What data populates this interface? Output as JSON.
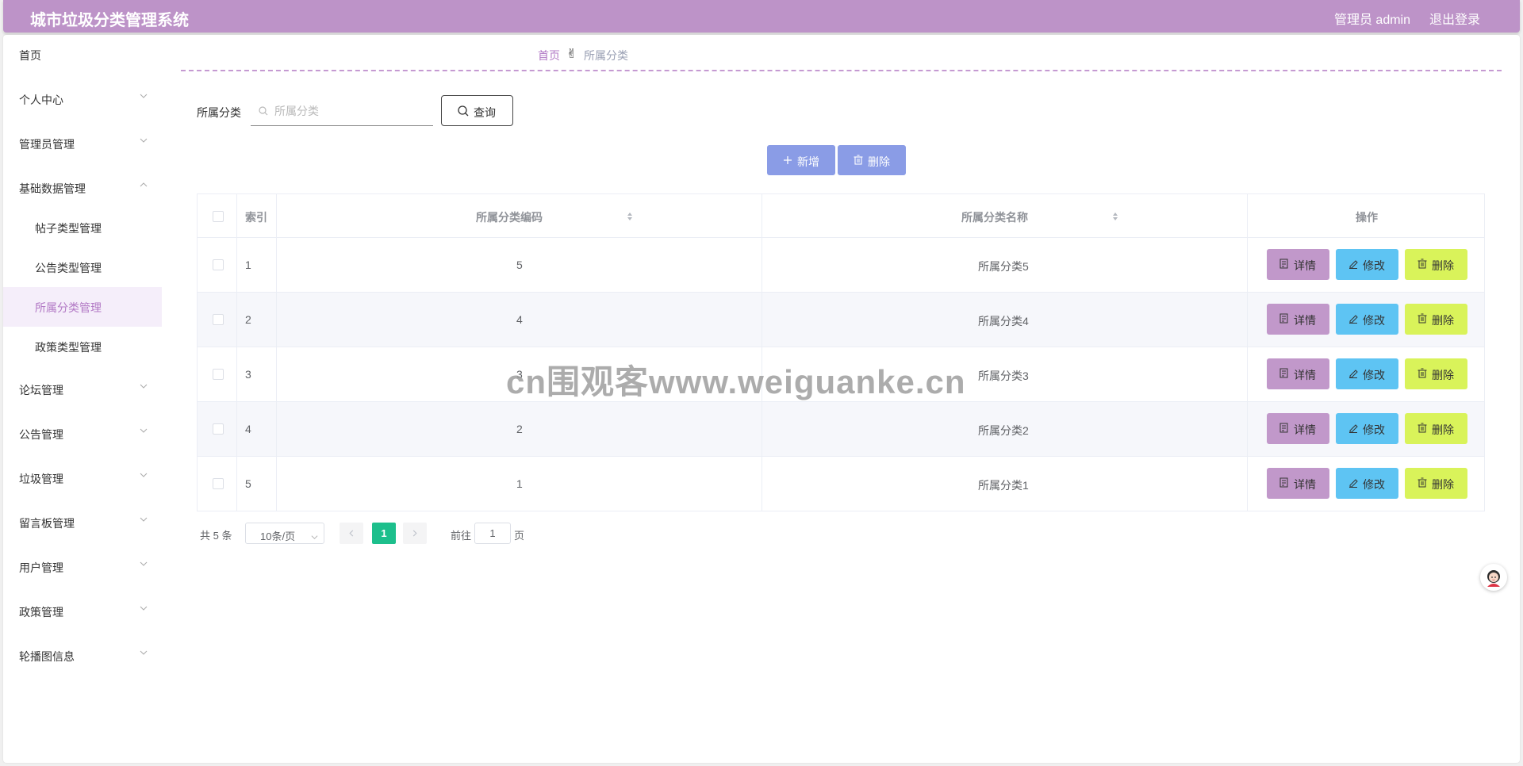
{
  "header": {
    "title": "城市垃圾分类管理系统",
    "admin_label": "管理员 admin",
    "logout_label": "退出登录"
  },
  "sidebar": {
    "items": [
      {
        "label": "首页"
      },
      {
        "label": "个人中心"
      },
      {
        "label": "管理员管理"
      },
      {
        "label": "基础数据管理"
      },
      {
        "label": "论坛管理"
      },
      {
        "label": "公告管理"
      },
      {
        "label": "垃圾管理"
      },
      {
        "label": "留言板管理"
      },
      {
        "label": "用户管理"
      },
      {
        "label": "政策管理"
      },
      {
        "label": "轮播图信息"
      }
    ],
    "sub_items": [
      {
        "label": "帖子类型管理"
      },
      {
        "label": "公告类型管理"
      },
      {
        "label": "所属分类管理"
      },
      {
        "label": "政策类型管理"
      }
    ]
  },
  "breadcrumb": {
    "home": "首页",
    "current": "所属分类"
  },
  "search": {
    "label": "所属分类",
    "placeholder": "所属分类",
    "value": "",
    "query_label": "查询"
  },
  "toolbar": {
    "add_label": "新增",
    "delete_label": "删除"
  },
  "table": {
    "columns": [
      "索引",
      "所属分类编码",
      "所属分类名称",
      "操作"
    ],
    "rows": [
      {
        "index": "1",
        "code": "5",
        "name": "所属分类5"
      },
      {
        "index": "2",
        "code": "4",
        "name": "所属分类4"
      },
      {
        "index": "3",
        "code": "3",
        "name": "所属分类3"
      },
      {
        "index": "4",
        "code": "2",
        "name": "所属分类2"
      },
      {
        "index": "5",
        "code": "1",
        "name": "所属分类1"
      }
    ],
    "actions": {
      "detail": "详情",
      "edit": "修改",
      "delete": "删除"
    }
  },
  "pagination": {
    "total_label": "共 5 条",
    "page_size": "10条/页",
    "current_page": "1",
    "goto_label": "前往",
    "goto_value": "1",
    "goto_suffix": "页"
  },
  "watermark": "cn围观客www.weiguanke.cn",
  "colors": {
    "header": "#bd93c8",
    "accent": "#b279c5",
    "add_button": "#8a9ce6",
    "detail_button": "#c198ca",
    "edit_button": "#5ec4f3",
    "delete_button": "#d9f35a",
    "page_active": "#1dbf8c"
  }
}
